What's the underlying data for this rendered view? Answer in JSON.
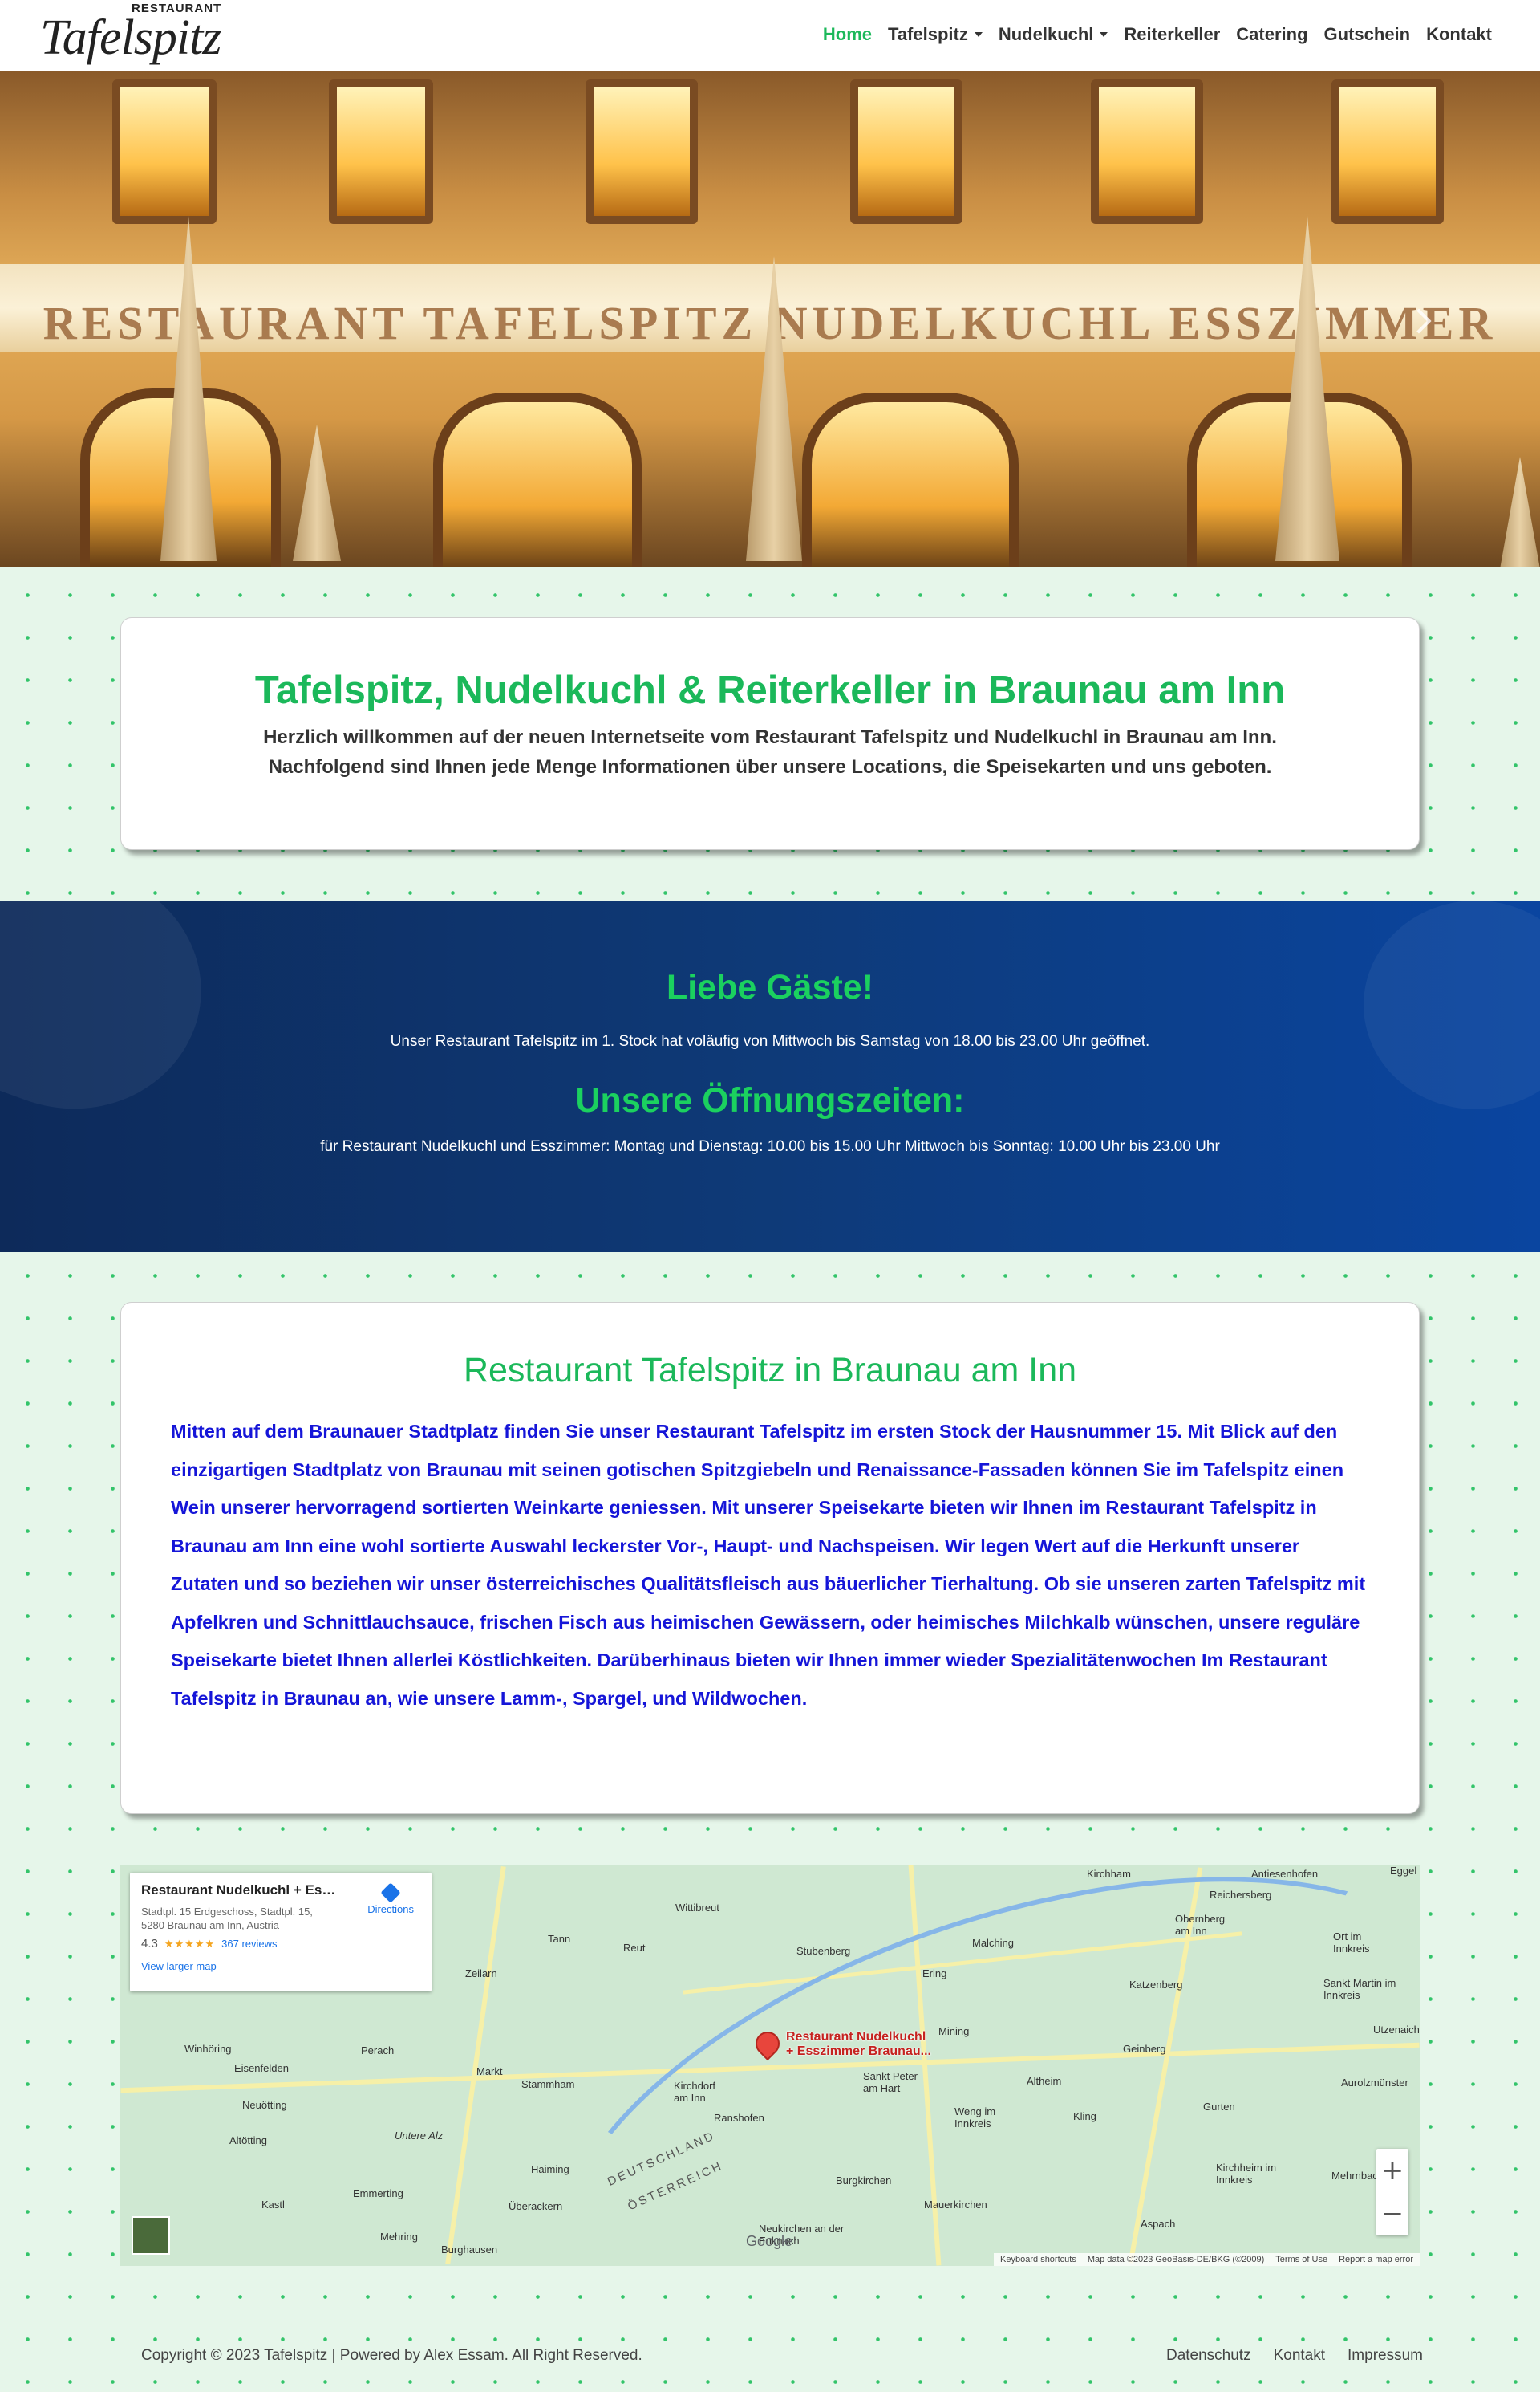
{
  "nav": {
    "logo_small": "RESTAURANT",
    "logo_script": "Tafelspitz",
    "items": [
      {
        "label": "Home",
        "active": true
      },
      {
        "label": "Tafelspitz",
        "dropdown": true
      },
      {
        "label": "Nudelkuchl",
        "dropdown": true
      },
      {
        "label": "Reiterkeller"
      },
      {
        "label": "Catering"
      },
      {
        "label": "Gutschein"
      },
      {
        "label": "Kontakt"
      }
    ]
  },
  "hero": {
    "sign_text": "RESTAURANT  TAFELSPITZ  NUDELKUCHL  ESSZIMMER"
  },
  "intro": {
    "title": "Tafelspitz, Nudelkuchl & Reiterkeller in Braunau am Inn",
    "text": "Herzlich willkommen auf der neuen Internetseite vom Restaurant Tafelspitz und Nudelkuchl in Braunau am Inn. Nachfolgend sind Ihnen jede Menge Informationen über unsere Locations, die Speisekarten und uns geboten."
  },
  "banner": {
    "heading1": "Liebe Gäste!",
    "text1": "Unser Restaurant Tafelspitz im 1. Stock hat voläufig von Mittwoch bis Samstag von 18.00 bis 23.00 Uhr geöffnet.",
    "heading2": "Unsere Öffnungszeiten:",
    "text2": "für Restaurant Nudelkuchl und Esszimmer: Montag und Dienstag: 10.00 bis 15.00 Uhr Mittwoch bis Sonntag: 10.00 Uhr bis 23.00 Uhr"
  },
  "about": {
    "title": "Restaurant Tafelspitz in Braunau am Inn",
    "text": "Mitten auf dem Braunauer Stadtplatz finden Sie unser Restaurant Tafelspitz im ersten Stock der Hausnummer 15. Mit Blick auf den einzigartigen Stadtplatz von Braunau mit seinen gotischen Spitzgiebeln und Renaissance-Fassaden können Sie im Tafelspitz einen Wein unserer hervorragend sortierten Weinkarte geniessen. Mit unserer Speisekarte bieten wir Ihnen im Restaurant Tafelspitz in Braunau am Inn eine wohl sortierte Auswahl leckerster Vor-, Haupt- und Nachspeisen. Wir legen Wert auf die Herkunft unserer Zutaten und so beziehen wir unser österreichisches Qualitätsfleisch aus bäuerlicher Tierhaltung. Ob sie unseren zarten Tafelspitz mit Apfelkren und Schnittlauchsauce, frischen Fisch aus heimischen Gewässern, oder heimisches Milchkalb wünschen, unsere reguläre Speisekarte bietet Ihnen allerlei Köstlichkeiten. Darüberhinaus bieten wir Ihnen immer wieder Spezialitätenwochen Im Restaurant Tafelspitz in Braunau an, wie unsere Lamm-, Spargel, und Wildwochen."
  },
  "map": {
    "place_title": "Restaurant Nudelkuchl + Esszi...",
    "address_line1": "Stadtpl. 15 Erdgeschoss, Stadtpl. 15,",
    "address_line2": "5280 Braunau am Inn, Austria",
    "rating": "4.3",
    "stars": "★★★★★",
    "reviews": "367 reviews",
    "larger_map": "View larger map",
    "directions": "Directions",
    "pin_label_1": "Restaurant Nudelkuchl",
    "pin_label_2": "+ Esszimmer Braunau...",
    "zoom_in": "+",
    "zoom_out": "−",
    "google": "Google",
    "attr_shortcuts": "Keyboard shortcuts",
    "attr_data": "Map data ©2023 GeoBasis-DE/BKG (©2009)",
    "attr_terms": "Terms of Use",
    "attr_report": "Report a map error",
    "places": [
      "Kirchham",
      "Antiesenhofen",
      "Eggel",
      "Reichersberg",
      "Wittibreut",
      "Obernberg am Inn",
      "Tann",
      "Reut",
      "Stubenberg",
      "Malching",
      "Ort im Innkreis",
      "Zeilarn",
      "Ering",
      "Katzenberg",
      "Sankt Martin im Innkreis",
      "Winhöring",
      "Perach",
      "Mining",
      "Utzenaich",
      "Eisenfelden",
      "Markt",
      "Stammham",
      "Kirchdorf am Inn",
      "Sankt Peter am Hart",
      "Altheim",
      "Geinberg",
      "Neuötting",
      "Ranshofen",
      "Aurolzmünster",
      "Altötting",
      "Untere Alz",
      "Weng im Innkreis",
      "Kling",
      "Gurten",
      "Haiming",
      "Kirchheim im Innkreis",
      "Emmerting",
      "Überackern",
      "Burgkirchen",
      "Mauerkirchen",
      "Mehring",
      "Kastl",
      "Burghausen",
      "Neukirchen an der Enknach",
      "Aspach",
      "Mehrnbach",
      "DEUTSCHLAND",
      "ÖSTERREICH"
    ]
  },
  "footer": {
    "copyright": "Copyright © 2023 Tafelspitz | Powered by Alex Essam. All Right Reserved.",
    "links": [
      "Datenschutz",
      "Kontakt",
      "Impressum"
    ]
  },
  "colors": {
    "accent_green": "#1bb85a",
    "body_blue": "#1515d8",
    "banner_navy": "#0e3a78"
  }
}
